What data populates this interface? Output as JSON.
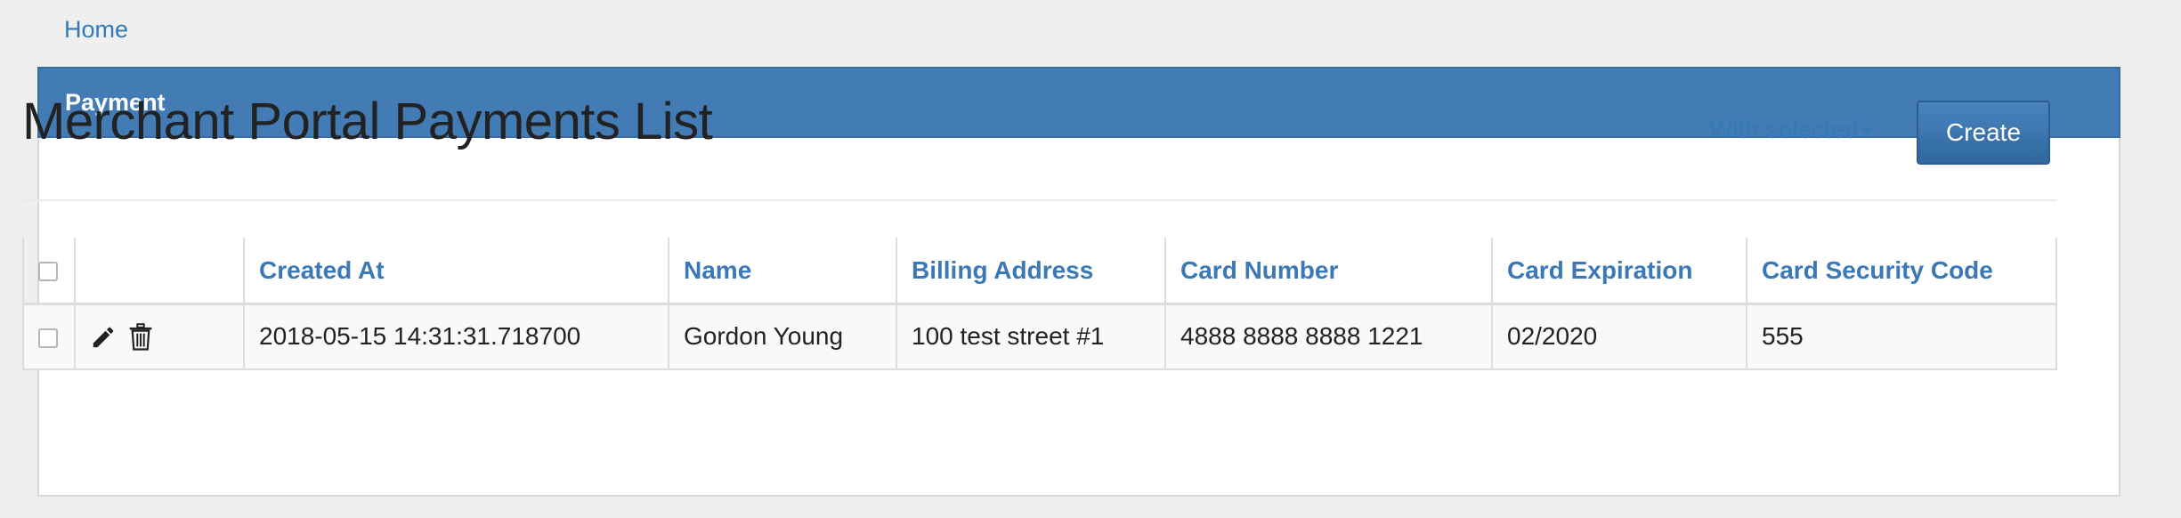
{
  "breadcrumb": {
    "home": "Home"
  },
  "panel": {
    "heading": "Payment"
  },
  "page": {
    "title": "Merchant Portal Payments List",
    "with_selected": "With selected",
    "create_label": "Create"
  },
  "table": {
    "columns": [
      "Created At",
      "Name",
      "Billing Address",
      "Card Number",
      "Card Expiration",
      "Card Security Code"
    ],
    "rows": [
      {
        "created_at": "2018-05-15 14:31:31.718700",
        "name": "Gordon Young",
        "billing_address": "100 test street #1",
        "card_number": "4888 8888 8888 1221",
        "card_expiration": "02/2020",
        "card_security_code": "555",
        "actions": [
          "pencil-icon",
          "trash-icon"
        ]
      }
    ]
  },
  "colors": {
    "link": "#337ab7",
    "panel_heading": "#437bb4",
    "button": "#2f679f"
  }
}
